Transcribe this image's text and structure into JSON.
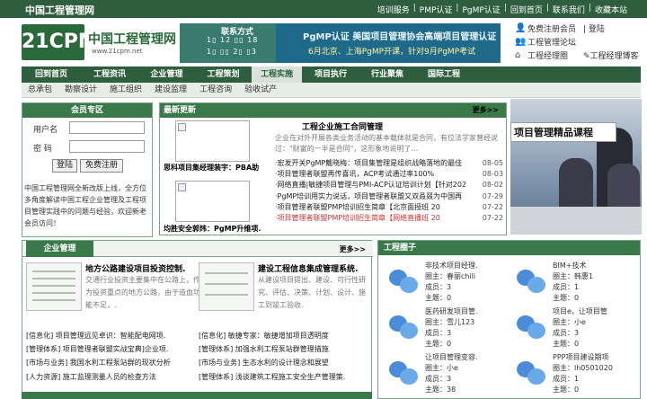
{
  "top": {
    "site_name": "中国工程管理网",
    "links": [
      "培训服务",
      "PMP认证",
      "PgMP认证",
      "回到首页",
      "联系我们",
      "收藏本站"
    ]
  },
  "logo": {
    "mark": "21CPM",
    "name": "中国工程管理网",
    "url": "www.21cpm.net"
  },
  "banner_contact": {
    "title": "联系方式",
    "line1": "1▯ 12 ▯▯ 18",
    "line2": "1▯ ▯▯ 2▯ ▯3"
  },
  "banner_pgmp": {
    "title": "PgMP认证 美国项目管理协会高端项目管理认证",
    "subtitle": "6月北京、上海PgMP开课，针对9月PgMP考试"
  },
  "right_links": [
    {
      "icon": "user-icon",
      "a": "免费注册会员",
      "b": "登陆"
    },
    {
      "icon": "forum-icon",
      "a": "工程管理论坛",
      "b": ""
    },
    {
      "icon": "home-icon",
      "a": "工程经理圈",
      "b": "工程经理博客"
    }
  ],
  "nav": [
    "回到首页",
    "工程资讯",
    "企业管理",
    "工程策划",
    "工程实施",
    "项目执行",
    "行业聚焦",
    "国际工程"
  ],
  "nav_active": "工程实施",
  "subnav": [
    "总承包",
    "勘察设计",
    "施工组织",
    "建设监理",
    "工程咨询",
    "验收试产"
  ],
  "member": {
    "title": "会员专区",
    "user_label": "用户名",
    "pass_label": "密 码",
    "login": "登陆",
    "register": "免费注册",
    "desc": "中国工程管理网全新改版上线，全方位多角度解读中国工程企业管理及工程项目管理实践中的问题与经验，欢迎新老会员访问！"
  },
  "latest": {
    "title": "最新更新",
    "more": "更多>>",
    "thumb1_caption": "思科项目集经理装宇：PBA助",
    "thumb2_caption": "均胜安全郭炜：PgMP升维项.",
    "headline": "工程企业施工合同管理",
    "summary": "企业在对外开展各类业务活动的基本载体就是合同，有位法学家曾经说过：\"财富的一半是合同\"，这形象地说明了…",
    "items": [
      {
        "text": "·宏发开关PgMP戴晓梅：项目集管理是组织战略落地的最佳",
        "date": "08-05",
        "red": false
      },
      {
        "text": "·项目管理者联盟再传喜讯，ACP考试通过率100%",
        "date": "08-03",
        "red": false
      },
      {
        "text": "·网络直播|敏捷项目管理与PMI-ACP认证培训计划【针对202",
        "date": "08-02",
        "red": false
      },
      {
        "text": "·PgMP培训用实力说话，项目管理者联盟又双叒叕为中国再",
        "date": "07-29",
        "red": false
      },
      {
        "text": "·项目管理者联盟PMP培训招生简章【北京面授班 20",
        "date": "07-22",
        "red": false
      },
      {
        "text": "·项目管理者联盟PMP培训招生简章【网络直播班 20",
        "date": "07-22",
        "red": true
      }
    ]
  },
  "promo": {
    "caption": "项目管理精品课程"
  },
  "mgmt": {
    "tab": "企业管理",
    "more": "更多>>",
    "art1_title": "地方公路建设项目投资控制.",
    "art1_body": "交通行业投资主要集中在公路上，作为投资重点的地方公路，由于造血功能不足，.",
    "art2_title": "建设工程信息集成管理系统.",
    "art2_body": "从建设项目提出、建设、可行性研究、评估、决策、计划、设计、施工到竣工验收.",
    "links_left": [
      "[信息化] 项目管理远见卓识：智能配电网项.",
      "[管理体系] 项目管理者联盟实战宝典]企业项.",
      "[市场与业务] 我国水利工程泵站群的现状分析",
      "[人力资源] 施工监理测量人员的检查方法"
    ],
    "links_right": [
      "[信息化] 敏捷专家：敏捷增加项目透明度",
      "[管理体系] 加强水利工程泵站群管理措施",
      "[市场与业务] 生态水利的设计理念和展望",
      "[管理体系] 浅谈建筑工程施工安全生产管理策."
    ]
  },
  "circle": {
    "title": "工程圈子",
    "groups": [
      {
        "name": "非技术项目经理.",
        "owner": "圈主：春丽chili",
        "members": "成员：3",
        "topics": "主题：0"
      },
      {
        "name": "BIM+技术",
        "owner": "圈主：韩惠1",
        "members": "成员：1",
        "topics": "主题：0"
      },
      {
        "name": "医药研发项目管.",
        "owner": "圈主：雪儿123",
        "members": "成员：3",
        "topics": "主题：0"
      },
      {
        "name": "项目e，让项目管",
        "owner": "圈主：小e",
        "members": "成员：3",
        "topics": "主题：0"
      },
      {
        "name": "让项目管理变容.",
        "owner": "圈主：小e",
        "members": "成员：3",
        "topics": "主题：38"
      },
      {
        "name": "PPP项目建设期项",
        "owner": "圈主：lh0501020",
        "members": "成员：1",
        "topics": "主题：0"
      }
    ]
  }
}
